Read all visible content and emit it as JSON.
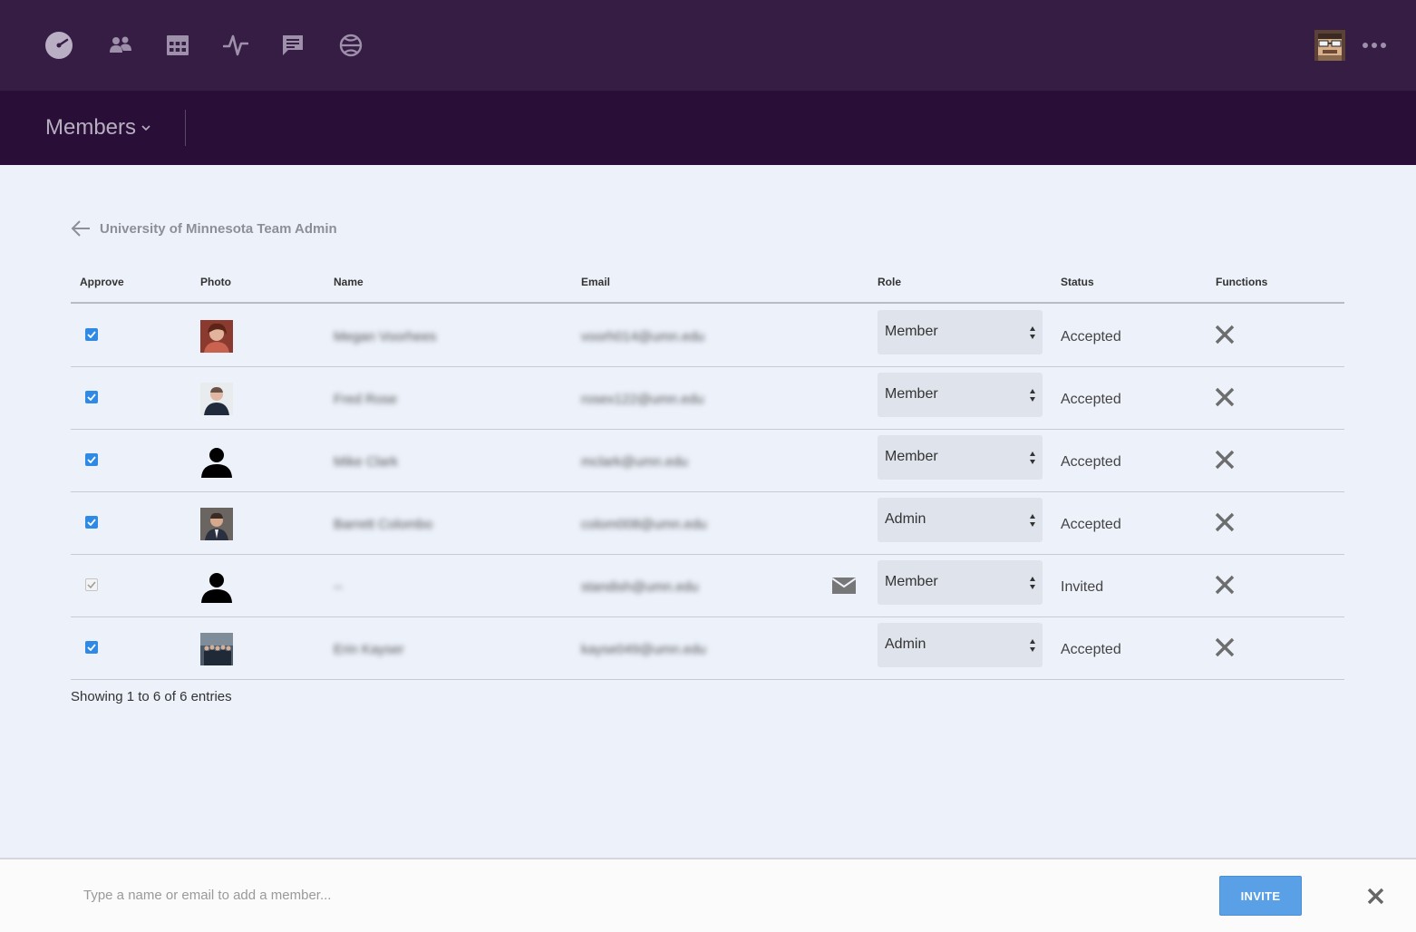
{
  "nav": {
    "icons": [
      "dashboard-icon",
      "members-icon",
      "grid-icon",
      "activity-icon",
      "chat-icon",
      "basketball-icon"
    ],
    "more_icon": "more-dots-icon"
  },
  "section": {
    "title": "Members"
  },
  "back": {
    "title": "University of Minnesota Team Admin"
  },
  "table": {
    "headers": {
      "approve": "Approve",
      "photo": "Photo",
      "name": "Name",
      "email": "Email",
      "role": "Role",
      "status": "Status",
      "functions": "Functions"
    },
    "rows": [
      {
        "approved": true,
        "name": "Megan Voorhees",
        "email": "voorh014@umn.edu",
        "role": "Member",
        "status": "Accepted",
        "photo": "photo-woman"
      },
      {
        "approved": true,
        "name": "Fred Rose",
        "email": "rosex122@umn.edu",
        "role": "Member",
        "status": "Accepted",
        "photo": "photo-man-light"
      },
      {
        "approved": true,
        "name": "Mike Clark",
        "email": "mclark@umn.edu",
        "role": "Member",
        "status": "Accepted",
        "photo": "default-avatar"
      },
      {
        "approved": true,
        "name": "Barrett Colombo",
        "email": "colom008@umn.edu",
        "role": "Admin",
        "status": "Accepted",
        "photo": "photo-man-suit"
      },
      {
        "approved": true,
        "approve_disabled": true,
        "name": "--",
        "email": "standish@umn.edu",
        "role": "Member",
        "status": "Invited",
        "photo": "default-avatar",
        "has_mail_icon": true
      },
      {
        "approved": true,
        "name": "Erin Kayser",
        "email": "kayse049@umn.edu",
        "role": "Admin",
        "status": "Accepted",
        "photo": "photo-group"
      }
    ]
  },
  "entries": "Showing 1 to 6 of 6 entries",
  "footer": {
    "placeholder": "Type a name or email to add a member...",
    "invite_label": "INVITE"
  },
  "colors": {
    "topbar": "#361d44",
    "subbar": "#290f38",
    "background": "#ecf1fa",
    "checkbox": "#2f8ae6",
    "invite_button": "#5aa0e6"
  }
}
